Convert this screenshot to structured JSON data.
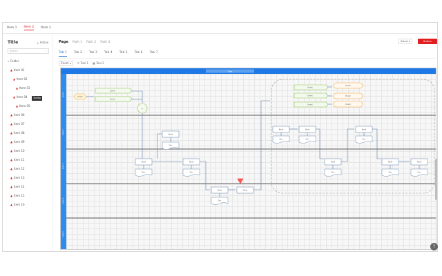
{
  "topnav": {
    "items": [
      {
        "label": "Item 1",
        "active": false
      },
      {
        "label": "Item 2",
        "active": true
      },
      {
        "label": "Item 3",
        "active": false
      }
    ]
  },
  "sidebar": {
    "title": "Title",
    "action_label": "Action",
    "search_placeholder": "Search",
    "items": [
      {
        "label": "Folder",
        "level": 0,
        "type": "folder"
      },
      {
        "label": "Item 01",
        "level": 1,
        "type": "item"
      },
      {
        "label": "Item 02",
        "level": 2,
        "type": "item"
      },
      {
        "label": "Item 03",
        "level": 3,
        "type": "item"
      },
      {
        "label": "Item 04",
        "level": 2,
        "type": "item"
      },
      {
        "label": "Item 05",
        "level": 3,
        "type": "item"
      },
      {
        "label": "Item 06",
        "level": 1,
        "type": "item"
      },
      {
        "label": "Item 07",
        "level": 1,
        "type": "item"
      },
      {
        "label": "Item 08",
        "level": 1,
        "type": "item"
      },
      {
        "label": "Item 09",
        "level": 1,
        "type": "item"
      },
      {
        "label": "Item 10",
        "level": 1,
        "type": "item"
      },
      {
        "label": "Item 11",
        "level": 1,
        "type": "item"
      },
      {
        "label": "Item 12",
        "level": 1,
        "type": "item"
      },
      {
        "label": "Item 13",
        "level": 1,
        "type": "item"
      },
      {
        "label": "Item 14",
        "level": 1,
        "type": "item"
      },
      {
        "label": "Item 15",
        "level": 1,
        "type": "item"
      },
      {
        "label": "Item 16",
        "level": 1,
        "type": "item"
      }
    ],
    "tooltip": "Tooltip"
  },
  "header": {
    "crumbs": [
      "Page",
      "Path 1",
      "Path 2",
      "Path 3"
    ],
    "select_label": "Select",
    "primary_button": "Button"
  },
  "tabs": [
    {
      "label": "Tab 1",
      "active": true
    },
    {
      "label": "Tab 2",
      "active": false
    },
    {
      "label": "Tab 3",
      "active": false
    },
    {
      "label": "Tab 4",
      "active": false
    },
    {
      "label": "Tab 5",
      "active": false
    },
    {
      "label": "Tab 6",
      "active": false
    },
    {
      "label": "Tab 7",
      "active": false
    }
  ],
  "toolbar": {
    "zoom_label": "Zoom",
    "tools": [
      "Tool 1",
      "Tool 2"
    ]
  },
  "diagram": {
    "title": "Title",
    "lanes": [
      "Lane 1",
      "Lane 2",
      "Lane 3",
      "Lane 4",
      "Lane 5"
    ],
    "node_label": "Node",
    "doc_label": "Doc",
    "event_label": "Event",
    "merge_label": "+"
  },
  "colors": {
    "accent": "#e02020",
    "lane_header": "#2d8cf0",
    "title_bar": "#1e78e6",
    "node_border": "#5b7ea6",
    "event_green": "#8bc34a",
    "event_orange": "#f0a040",
    "start_node": "#f3b33d",
    "merge_circle": "#8bc34a",
    "doc_border": "#6a8bb0"
  }
}
